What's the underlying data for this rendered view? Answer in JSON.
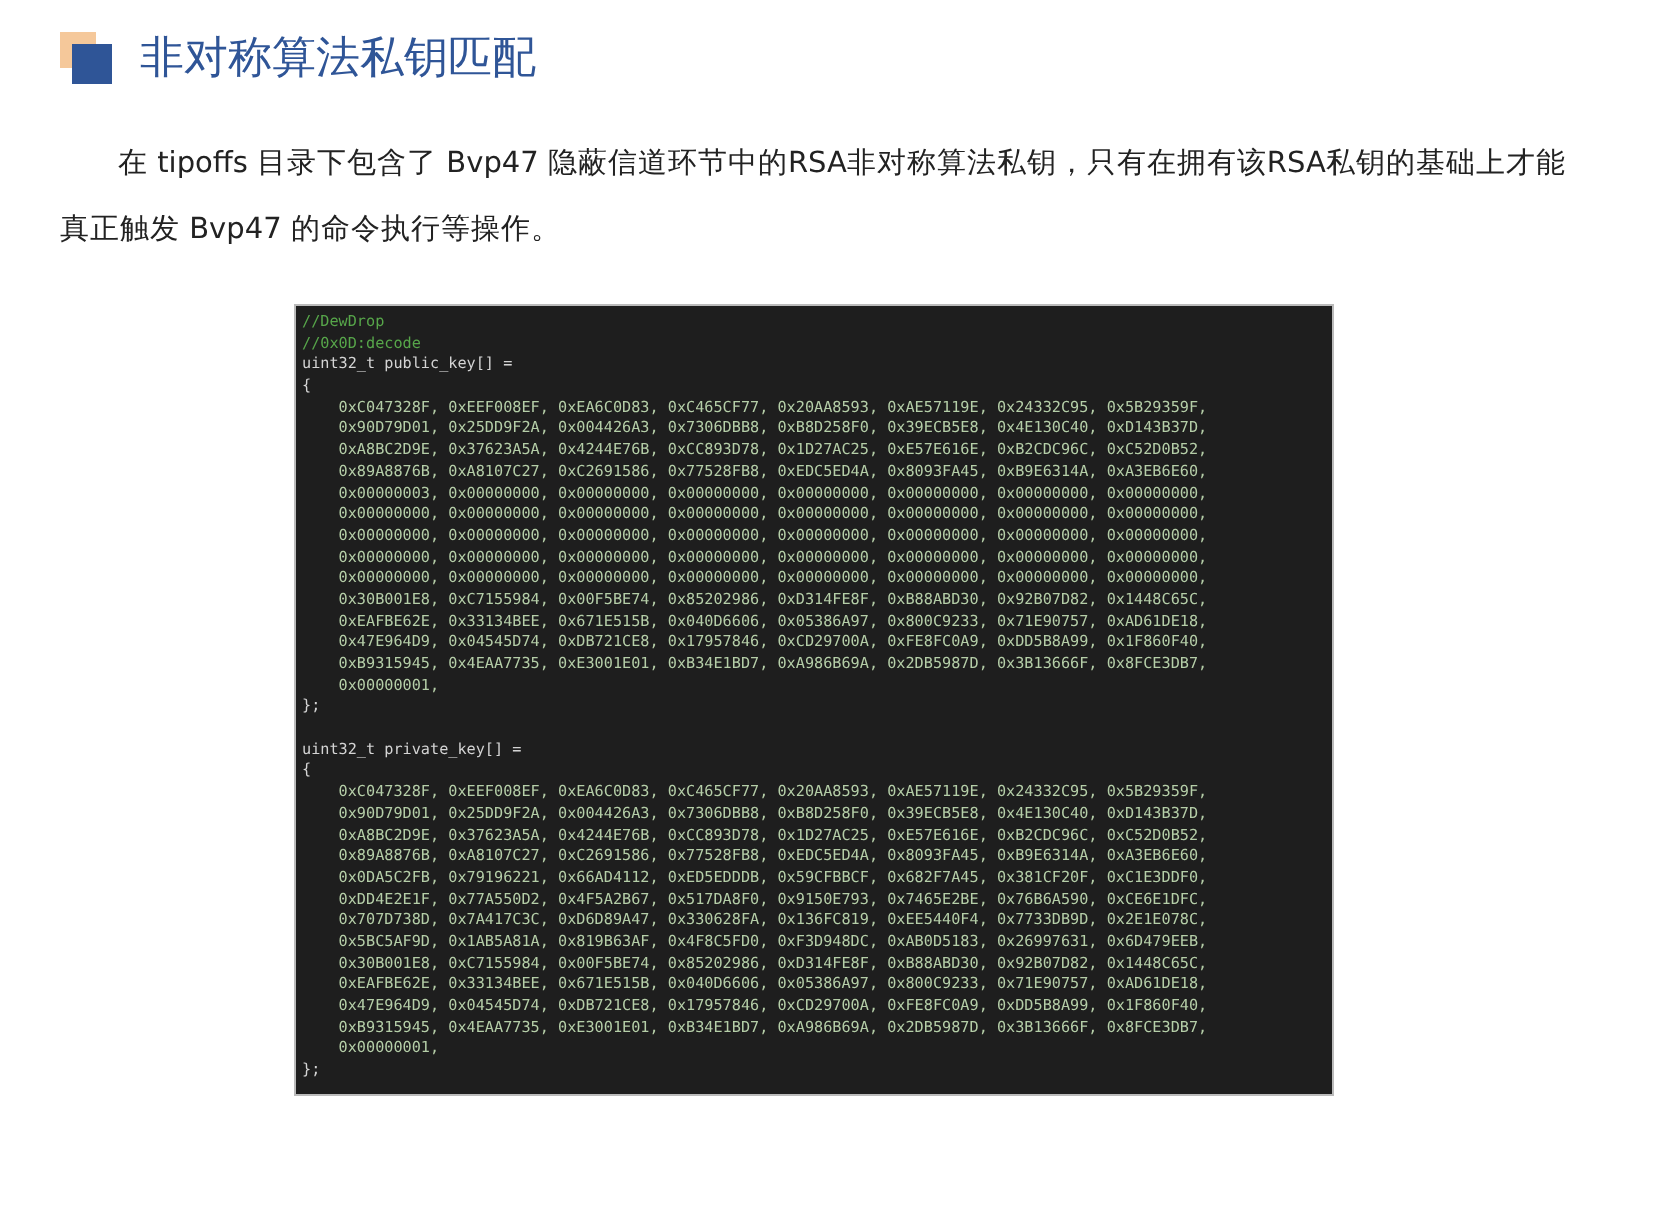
{
  "heading": {
    "title": "非对称算法私钥匹配"
  },
  "paragraph": "在 tipoffs 目录下包含了 Bvp47 隐蔽信道环节中的RSA非对称算法私钥，只有在拥有该RSA私钥的基础上才能真正触发 Bvp47 的命令执行等操作。",
  "code_block": {
    "lines": [
      {
        "kind": "comment",
        "text": "//DewDrop"
      },
      {
        "kind": "comment",
        "text": "//0x0D:decode"
      },
      {
        "kind": "code",
        "text": "uint32_t public_key[] ="
      },
      {
        "kind": "code",
        "text": "{"
      },
      {
        "kind": "values",
        "text": "    0xC047328F, 0xEEF008EF, 0xEA6C0D83, 0xC465CF77, 0x20AA8593, 0xAE57119E, 0x24332C95, 0x5B29359F,"
      },
      {
        "kind": "values",
        "text": "    0x90D79D01, 0x25DD9F2A, 0x004426A3, 0x7306DBB8, 0xB8D258F0, 0x39ECB5E8, 0x4E130C40, 0xD143B37D,"
      },
      {
        "kind": "values",
        "text": "    0xA8BC2D9E, 0x37623A5A, 0x4244E76B, 0xCC893D78, 0x1D27AC25, 0xE57E616E, 0xB2CDC96C, 0xC52D0B52,"
      },
      {
        "kind": "values",
        "text": "    0x89A8876B, 0xA8107C27, 0xC2691586, 0x77528FB8, 0xEDC5ED4A, 0x8093FA45, 0xB9E6314A, 0xA3EB6E60,"
      },
      {
        "kind": "values",
        "text": "    0x00000003, 0x00000000, 0x00000000, 0x00000000, 0x00000000, 0x00000000, 0x00000000, 0x00000000,"
      },
      {
        "kind": "values",
        "text": "    0x00000000, 0x00000000, 0x00000000, 0x00000000, 0x00000000, 0x00000000, 0x00000000, 0x00000000,"
      },
      {
        "kind": "values",
        "text": "    0x00000000, 0x00000000, 0x00000000, 0x00000000, 0x00000000, 0x00000000, 0x00000000, 0x00000000,"
      },
      {
        "kind": "values",
        "text": "    0x00000000, 0x00000000, 0x00000000, 0x00000000, 0x00000000, 0x00000000, 0x00000000, 0x00000000,"
      },
      {
        "kind": "values",
        "text": "    0x00000000, 0x00000000, 0x00000000, 0x00000000, 0x00000000, 0x00000000, 0x00000000, 0x00000000,"
      },
      {
        "kind": "values",
        "text": "    0x30B001E8, 0xC7155984, 0x00F5BE74, 0x85202986, 0xD314FE8F, 0xB88ABD30, 0x92B07D82, 0x1448C65C,"
      },
      {
        "kind": "values",
        "text": "    0xEAFBE62E, 0x33134BEE, 0x671E515B, 0x040D6606, 0x05386A97, 0x800C9233, 0x71E90757, 0xAD61DE18,"
      },
      {
        "kind": "values",
        "text": "    0x47E964D9, 0x04545D74, 0xDB721CE8, 0x17957846, 0xCD29700A, 0xFE8FC0A9, 0xDD5B8A99, 0x1F860F40,"
      },
      {
        "kind": "values",
        "text": "    0xB9315945, 0x4EAA7735, 0xE3001E01, 0xB34E1BD7, 0xA986B69A, 0x2DB5987D, 0x3B13666F, 0x8FCE3DB7,"
      },
      {
        "kind": "values",
        "text": "    0x00000001,"
      },
      {
        "kind": "code",
        "text": "};"
      },
      {
        "kind": "blank"
      },
      {
        "kind": "code",
        "text": "uint32_t private_key[] ="
      },
      {
        "kind": "code",
        "text": "{"
      },
      {
        "kind": "values",
        "text": "    0xC047328F, 0xEEF008EF, 0xEA6C0D83, 0xC465CF77, 0x20AA8593, 0xAE57119E, 0x24332C95, 0x5B29359F,"
      },
      {
        "kind": "values",
        "text": "    0x90D79D01, 0x25DD9F2A, 0x004426A3, 0x7306DBB8, 0xB8D258F0, 0x39ECB5E8, 0x4E130C40, 0xD143B37D,"
      },
      {
        "kind": "values",
        "text": "    0xA8BC2D9E, 0x37623A5A, 0x4244E76B, 0xCC893D78, 0x1D27AC25, 0xE57E616E, 0xB2CDC96C, 0xC52D0B52,"
      },
      {
        "kind": "values",
        "text": "    0x89A8876B, 0xA8107C27, 0xC2691586, 0x77528FB8, 0xEDC5ED4A, 0x8093FA45, 0xB9E6314A, 0xA3EB6E60,"
      },
      {
        "kind": "values",
        "text": "    0x0DA5C2FB, 0x79196221, 0x66AD4112, 0xED5EDDDB, 0x59CFBBCF, 0x682F7A45, 0x381CF20F, 0xC1E3DDF0,"
      },
      {
        "kind": "values",
        "text": "    0xDD4E2E1F, 0x77A550D2, 0x4F5A2B67, 0x517DA8F0, 0x9150E793, 0x7465E2BE, 0x76B6A590, 0xCE6E1DFC,"
      },
      {
        "kind": "values",
        "text": "    0x707D738D, 0x7A417C3C, 0xD6D89A47, 0x330628FA, 0x136FC819, 0xEE5440F4, 0x7733DB9D, 0x2E1E078C,"
      },
      {
        "kind": "values",
        "text": "    0x5BC5AF9D, 0x1AB5A81A, 0x819B63AF, 0x4F8C5FD0, 0xF3D948DC, 0xAB0D5183, 0x26997631, 0x6D479EEB,"
      },
      {
        "kind": "values",
        "text": "    0x30B001E8, 0xC7155984, 0x00F5BE74, 0x85202986, 0xD314FE8F, 0xB88ABD30, 0x92B07D82, 0x1448C65C,"
      },
      {
        "kind": "values",
        "text": "    0xEAFBE62E, 0x33134BEE, 0x671E515B, 0x040D6606, 0x05386A97, 0x800C9233, 0x71E90757, 0xAD61DE18,"
      },
      {
        "kind": "values",
        "text": "    0x47E964D9, 0x04545D74, 0xDB721CE8, 0x17957846, 0xCD29700A, 0xFE8FC0A9, 0xDD5B8A99, 0x1F860F40,"
      },
      {
        "kind": "values",
        "text": "    0xB9315945, 0x4EAA7735, 0xE3001E01, 0xB34E1BD7, 0xA986B69A, 0x2DB5987D, 0x3B13666F, 0x8FCE3DB7,"
      },
      {
        "kind": "values",
        "text": "    0x00000001,"
      },
      {
        "kind": "code",
        "text": "};"
      }
    ]
  }
}
